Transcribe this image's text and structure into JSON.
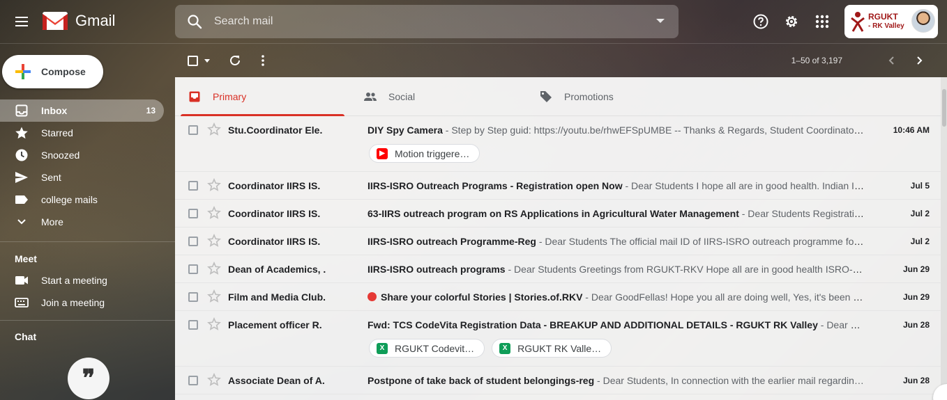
{
  "app": {
    "name": "Gmail"
  },
  "search": {
    "placeholder": "Search mail"
  },
  "account": {
    "org_name": "RGUKT",
    "org_sub": "- RK Valley"
  },
  "compose": {
    "label": "Compose"
  },
  "sidebar": {
    "items": [
      {
        "label": "Inbox",
        "icon": "inbox-icon",
        "count": "13",
        "active": true
      },
      {
        "label": "Starred",
        "icon": "star-icon"
      },
      {
        "label": "Snoozed",
        "icon": "clock-icon"
      },
      {
        "label": "Sent",
        "icon": "send-icon"
      },
      {
        "label": "college mails",
        "icon": "label-icon"
      },
      {
        "label": "More",
        "icon": "chevron-down-icon"
      }
    ],
    "meet": {
      "title": "Meet",
      "items": [
        {
          "label": "Start a meeting",
          "icon": "video-icon"
        },
        {
          "label": "Join a meeting",
          "icon": "keyboard-icon"
        }
      ]
    },
    "chat": {
      "title": "Chat"
    }
  },
  "toolbar": {
    "pager": "1–50 of 3,197"
  },
  "tabs": [
    {
      "label": "Primary",
      "icon": "inbox-icon",
      "active": true
    },
    {
      "label": "Social",
      "icon": "people-icon"
    },
    {
      "label": "Promotions",
      "icon": "tag-icon"
    }
  ],
  "emails": [
    {
      "sender": "Stu.Coordinator Ele.",
      "subject": "DIY Spy Camera",
      "snippet": " - Step by Step guid: https://youtu.be/rhwEFSpUMBE -- Thanks & Regards, Student Coordinator…",
      "date": "10:46 AM",
      "attachments": [
        {
          "label": "Motion triggere…",
          "type": "youtube"
        }
      ]
    },
    {
      "sender": "Coordinator IIRS IS.",
      "subject": "IIRS-ISRO Outreach Programs - Registration open Now",
      "snippet": " - Dear Students I hope all are in good health. Indian In…",
      "date": "Jul 5"
    },
    {
      "sender": "Coordinator IIRS IS.",
      "subject": "63-IIRS outreach program on RS Applications in Agricultural Water Management",
      "snippet": " - Dear Students Registration…",
      "date": "Jul 2"
    },
    {
      "sender": "Coordinator IIRS IS.",
      "subject": "IIRS-ISRO outreach Programme-Reg",
      "snippet": " - Dear Students The official mail ID of IIRS-ISRO outreach programme for…",
      "date": "Jul 2"
    },
    {
      "sender": "Dean of Academics, .",
      "subject": "IIRS-ISRO outreach programs",
      "snippet": " - Dear Students Greetings from RGUKT-RKV Hope all are in good health ISRO- IN…",
      "date": "Jun 29"
    },
    {
      "sender": "Film and Media Club.",
      "subject": "Share your colorful Stories | Stories.of.RKV",
      "snippet": " - Dear GoodFellas! Hope you all are doing well, Yes, it's been lo…",
      "date": "Jun 29",
      "red_dot": true
    },
    {
      "sender": "Placement officer R.",
      "subject": "Fwd: TCS CodeVita Registration Data - BREAKUP AND ADDITIONAL DETAILS - RGUKT RK Valley",
      "snippet": " - Dear all Pl …",
      "date": "Jun 28",
      "attachments": [
        {
          "label": "RGUKT Codevit…",
          "type": "sheet"
        },
        {
          "label": "RGUKT RK Valle…",
          "type": "sheet"
        }
      ]
    },
    {
      "sender": "Associate Dean of A.",
      "subject": "Postpone of take back of student belongings-reg",
      "snippet": " - Dear Students, In connection with the earlier mail regardin…",
      "date": "Jun 28"
    }
  ],
  "colors": {
    "accent": "#d93025",
    "youtube": "#ff0000",
    "sheet": "#0f9d58"
  },
  "chat_glyph": "❞"
}
